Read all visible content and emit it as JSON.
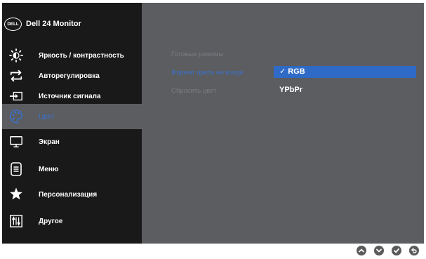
{
  "header": {
    "logo_text": "DELL",
    "title": "Dell 24 Monitor"
  },
  "sidebar": {
    "items": [
      {
        "label": "Яркость / контрастность",
        "icon": "brightness-icon"
      },
      {
        "label": "Авторегулировка",
        "icon": "auto-adjust-icon"
      },
      {
        "label": "Источник сигнала",
        "icon": "input-source-icon"
      },
      {
        "label": "Цвет",
        "icon": "color-palette-icon",
        "active": true
      },
      {
        "label": "Экран",
        "icon": "display-icon"
      },
      {
        "label": "Меню",
        "icon": "menu-icon"
      },
      {
        "label": "Персонализация",
        "icon": "star-icon"
      },
      {
        "label": "Другое",
        "icon": "other-icon"
      }
    ]
  },
  "main": {
    "options": [
      {
        "label": "Готовые режимы"
      },
      {
        "label": "Формат цвета на входе",
        "current": true
      },
      {
        "label": "Сбросить цвет"
      }
    ],
    "values": [
      {
        "label": "✓ RGB",
        "selected": true
      },
      {
        "label": "YPbPr",
        "selected": false
      }
    ]
  },
  "nav_buttons": [
    {
      "icon": "up-icon"
    },
    {
      "icon": "down-icon"
    },
    {
      "icon": "check-icon"
    },
    {
      "icon": "back-icon"
    }
  ],
  "colors": {
    "accent": "#2f6bc6",
    "sidebar_bg": "#191919",
    "panel_bg": "#5b5d61",
    "inactive_text": "#7a7c80"
  }
}
